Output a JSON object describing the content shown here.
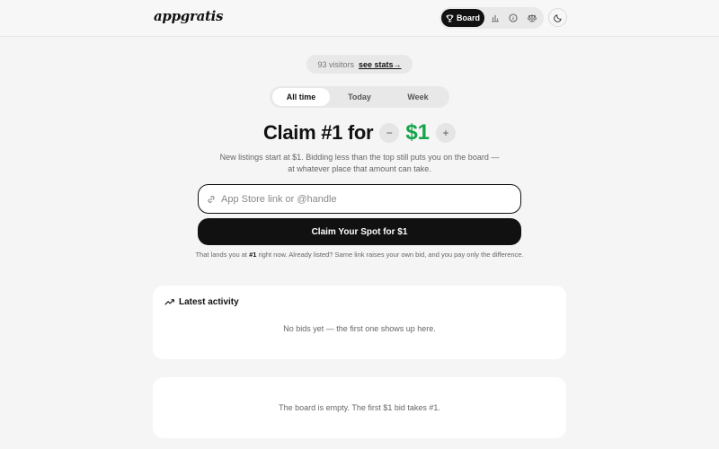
{
  "header": {
    "logo": "appgratis",
    "nav": {
      "board_label": "Board",
      "icons": [
        "trophy-icon",
        "bar-chart-icon",
        "info-icon",
        "scale-icon"
      ]
    },
    "theme_icon": "moon-icon"
  },
  "visitors": {
    "text": "93 visitors",
    "link": "see stats→"
  },
  "tabs": [
    {
      "label": "All time",
      "active": true
    },
    {
      "label": "Today",
      "active": false
    },
    {
      "label": "Week",
      "active": false
    }
  ],
  "headline": {
    "claim": "Claim #1 for",
    "minus": "−",
    "price": "$1",
    "plus": "+"
  },
  "subtext": "New listings start at $1. Bidding less than the top still puts you on the board — at whatever place that amount can take.",
  "input": {
    "placeholder": "App Store link or @handle",
    "value": ""
  },
  "cta_label": "Claim Your Spot for $1",
  "hint": {
    "prefix": "That lands you at ",
    "rank": "#1",
    "suffix": " right now. Already listed? Same link raises your own bid, and you pay only the difference."
  },
  "activity": {
    "title": "Latest activity",
    "empty": "No bids yet — the first one shows up here."
  },
  "board": {
    "empty": "The board is empty. The first $1 bid takes #1."
  },
  "colors": {
    "accent_green": "#16a34a",
    "primary_dark": "#111111",
    "background": "#f5f5f5"
  }
}
